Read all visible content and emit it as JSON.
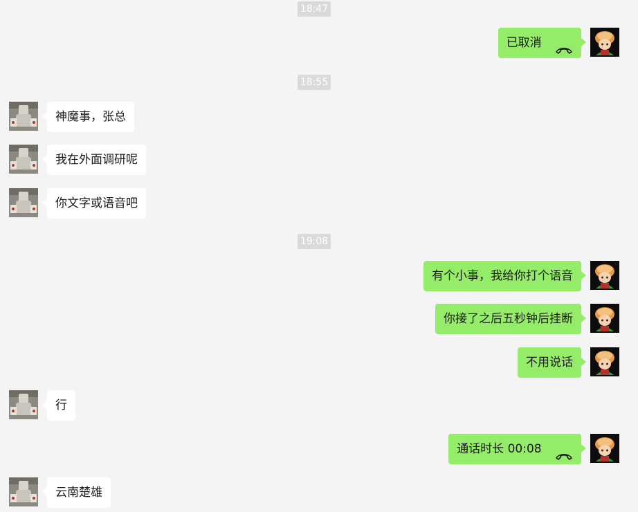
{
  "timestamps": [
    "18:47",
    "18:55",
    "19:08"
  ],
  "messages": [
    {
      "side": "me",
      "text": "已取消",
      "icon": "phone-hangup-icon"
    },
    {
      "side": "other",
      "text": "神魔事，张总"
    },
    {
      "side": "other",
      "text": "我在外面调研呢"
    },
    {
      "side": "other",
      "text": "你文字或语音吧"
    },
    {
      "side": "me",
      "text": "有个小事，我给你打个语音"
    },
    {
      "side": "me",
      "text": "你接了之后五秒钟后挂断"
    },
    {
      "side": "me",
      "text": "不用说话"
    },
    {
      "side": "other",
      "text": "行"
    },
    {
      "side": "me",
      "text": "通话时长 00:08",
      "icon": "phone-hangup-icon"
    },
    {
      "side": "other",
      "text": "云南楚雄"
    }
  ],
  "colors": {
    "background": "#f4f4f4",
    "my_bubble": "#95ec69",
    "other_bubble": "#ffffff",
    "timestamp_bg": "#dadada"
  }
}
